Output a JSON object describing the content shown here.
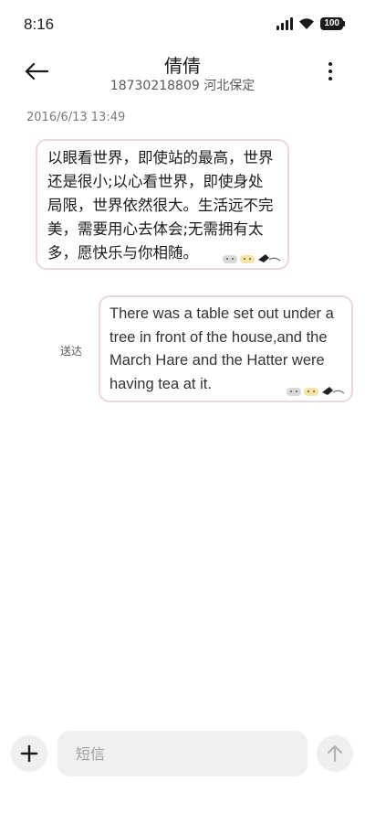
{
  "status_bar": {
    "time": "8:16",
    "battery": "100"
  },
  "header": {
    "contact_name": "倩倩",
    "contact_detail": "18730218809 河北保定"
  },
  "conversation": {
    "timestamp": "2016/6/13 13:49",
    "messages": [
      {
        "direction": "incoming",
        "text": "以眼看世界，即使站的最高，世界还是很小;以心看世界，即使身处局限，世界依然很大。生活远不完美，需要用心去体会;无需拥有太多，愿快乐与你相随。"
      },
      {
        "direction": "outgoing",
        "text": "There was a table set out under a tree in front of the house,and the March Hare and the Hatter were having tea at it.",
        "status": "送达"
      }
    ]
  },
  "composer": {
    "placeholder": "短信"
  },
  "colors": {
    "bubble_border": "#ecd7dd",
    "input_bg": "#efefef",
    "text": "#1a1a1a",
    "muted": "#7a7a7a"
  },
  "icons": [
    "back-arrow-icon",
    "more-vert-icon",
    "signal-icon",
    "wifi-icon",
    "battery-icon",
    "plus-icon",
    "send-arrow-icon",
    "cat-sticker-icon"
  ]
}
